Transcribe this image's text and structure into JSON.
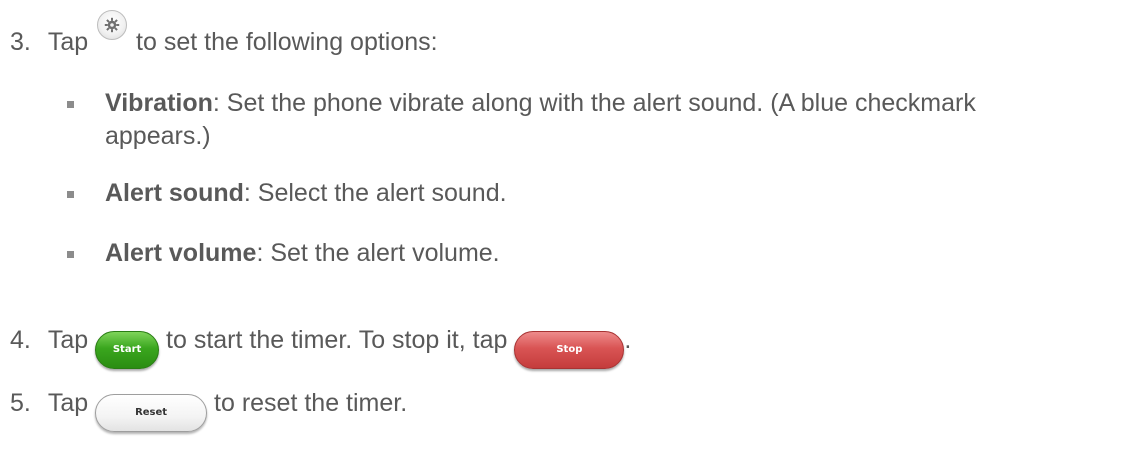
{
  "step3": {
    "number": "3.",
    "before": "Tap",
    "after": "to set the following options:",
    "icon": "gear-icon"
  },
  "options": [
    {
      "term": "Vibration",
      "text": ": Set the phone vibrate along with the alert sound. (A blue checkmark",
      "text2": "appears.)"
    },
    {
      "term": "Alert sound",
      "text": ": Select the alert sound."
    },
    {
      "term": "Alert volume",
      "text": ": Set the alert volume."
    }
  ],
  "step4": {
    "number": "4.",
    "before": "Tap",
    "middle": "to start the timer. To stop it, tap",
    "after": ".",
    "start_label": "Start",
    "stop_label": "Stop"
  },
  "step5": {
    "number": "5.",
    "before": "Tap",
    "after": "to reset the timer.",
    "reset_label": "Reset"
  },
  "colors": {
    "text": "#595959",
    "start_button": "#3aa61e",
    "stop_button": "#d95454",
    "reset_button": "#f4f4f4"
  }
}
